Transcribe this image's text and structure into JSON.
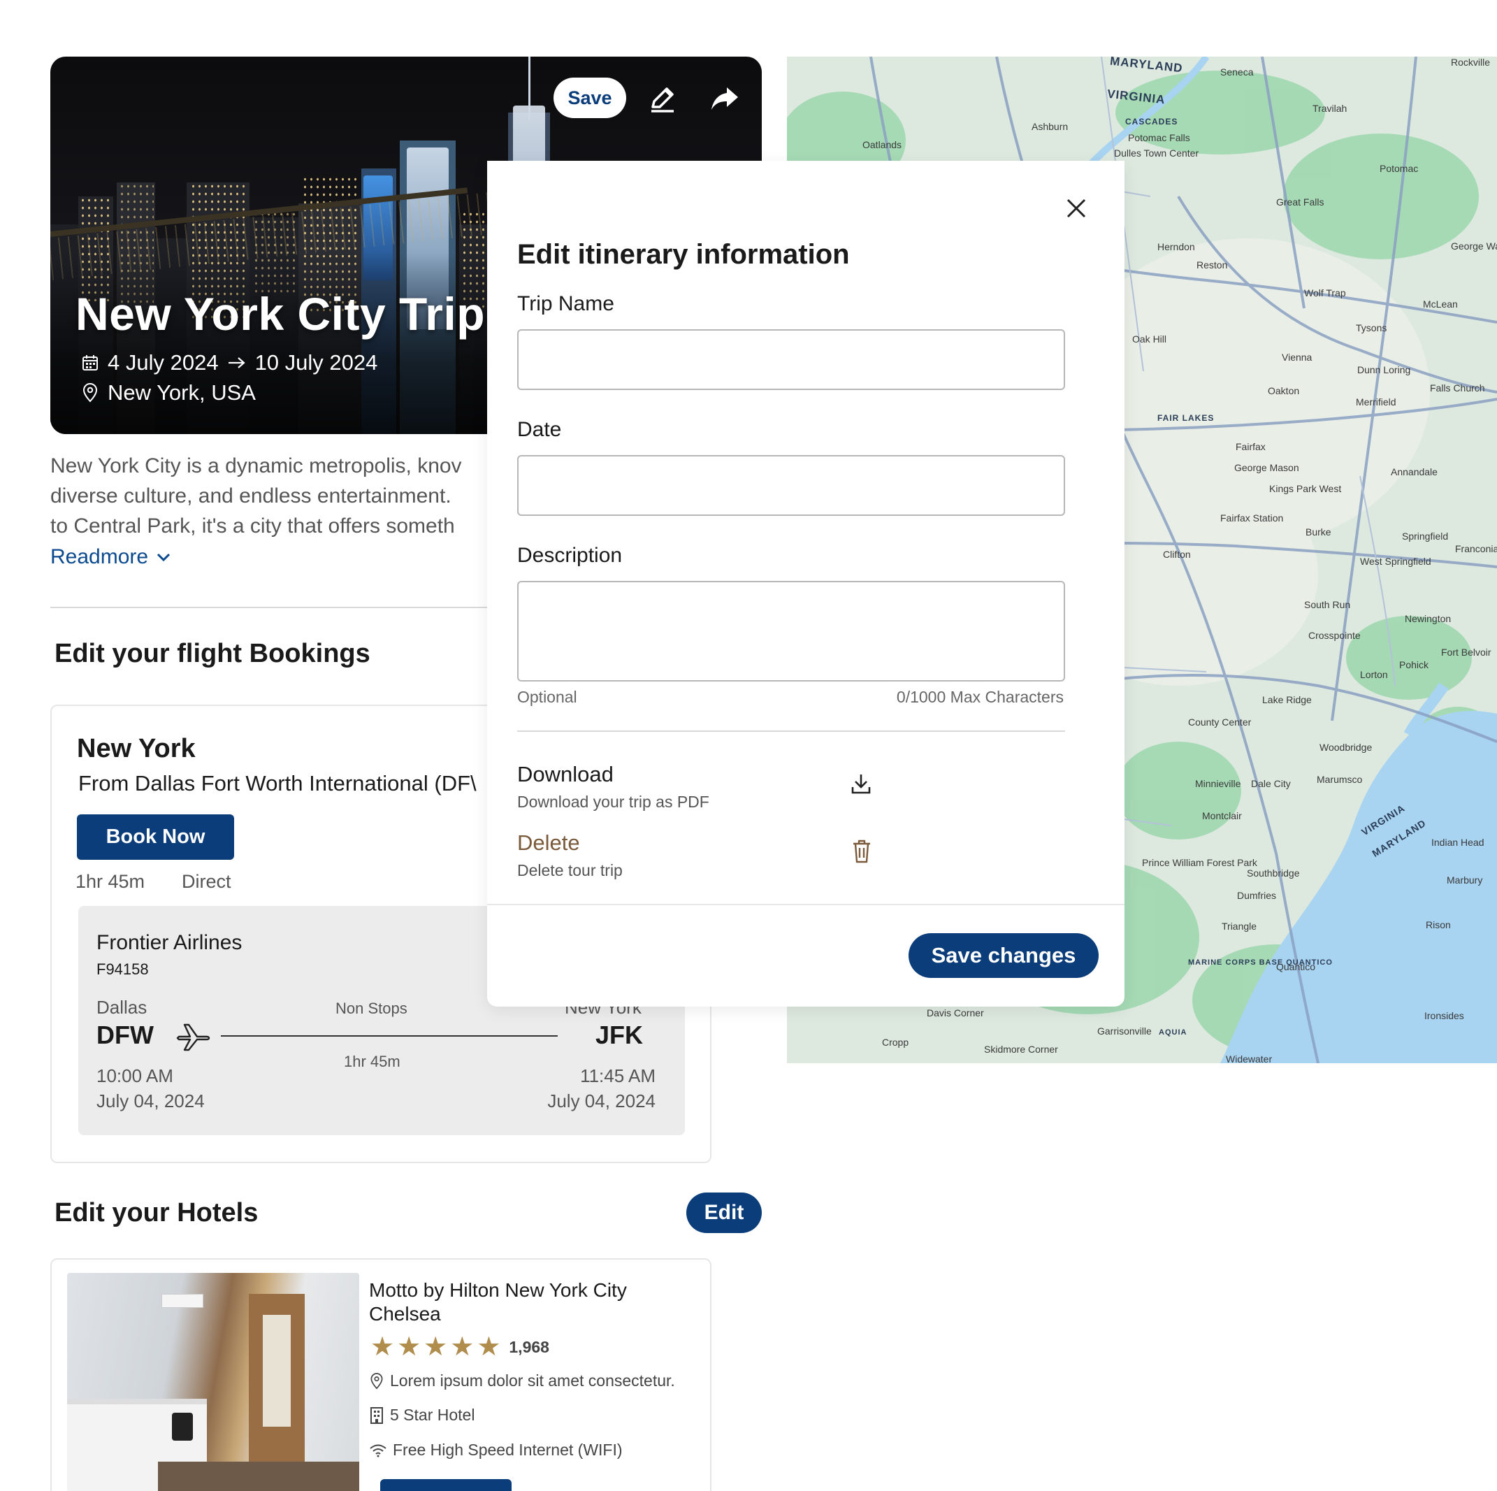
{
  "hero": {
    "title": "New York City Trip",
    "date_start": "4 July 2024",
    "date_end": "10 July 2024",
    "location": "New York, USA",
    "save_label": "Save",
    "icons": [
      "calendar-icon",
      "arrow-right-icon",
      "location-pin-icon",
      "pencil-icon",
      "share-icon"
    ]
  },
  "description": {
    "line1": "New York City is a dynamic metropolis, knov",
    "line2": "diverse culture, and endless entertainment.",
    "line3": "to Central Park, it's a city that offers someth",
    "readmore_label": "Readmore"
  },
  "flights": {
    "section_title": "Edit your flight Bookings",
    "destination": "New York",
    "origin_text": "From Dallas Fort Worth International (DF\\",
    "book_label": "Book Now",
    "duration": "1hr 45m",
    "stops": "Direct",
    "airline": "Frontier Airlines",
    "flight_no": "F94158",
    "from_city": "Dallas",
    "from_code": "DFW",
    "to_city": "New York",
    "to_code": "JFK",
    "route_stops": "Non Stops",
    "route_duration": "1hr 45m",
    "dep_time": "10:00 AM",
    "dep_date": "July 04, 2024",
    "arr_time": "11:45 AM",
    "arr_date": "July 04, 2024"
  },
  "hotels": {
    "section_title": "Edit your Hotels",
    "edit_label": "Edit",
    "name_line1": "Motto by Hilton New York City",
    "name_line2": "Chelsea",
    "rating_stars": 5,
    "reviews": "1,968",
    "address": "Lorem ipsum dolor sit amet consectetur.",
    "class": "5 Star Hotel",
    "amenity": "Free High Speed Internet (WIFI)"
  },
  "modal": {
    "title": "Edit itinerary information",
    "trip_name_label": "Trip Name",
    "trip_name_value": "",
    "date_label": "Date",
    "date_value": "",
    "description_label": "Description",
    "description_value": "",
    "optional_label": "Optional",
    "char_count": "0/1000 Max Characters",
    "download_title": "Download",
    "download_sub": "Download your trip as PDF",
    "delete_title": "Delete",
    "delete_sub": "Delete tour trip",
    "save_label": "Save changes"
  },
  "map": {
    "labels": [
      "MARYLAND",
      "VIRGINIA",
      "Seneca",
      "Rockville",
      "Travilah",
      "Potomac",
      "Ashburn",
      "Oatlands",
      "CASCADES",
      "Potomac Falls",
      "Dulles Town Center",
      "Great Falls",
      "Herndon",
      "Reston",
      "George Washington Memorial Parkway",
      "Wolf Trap",
      "McLean",
      "Tysons",
      "Oak Hill",
      "Vienna",
      "Dunn Loring",
      "Falls Church",
      "Oakton",
      "Merrifield",
      "FAIR LAKES",
      "Fairfax",
      "George Mason",
      "Annandale",
      "Kings Park West",
      "Fairfax Station",
      "Burke",
      "Springfield",
      "Franconia",
      "Clifton",
      "West Springfield",
      "South Run",
      "Newington",
      "Crosspointe",
      "Fort Belvoir",
      "Pohick",
      "Lorton",
      "Lake Ridge",
      "County Center",
      "Woodbridge",
      "Minnieville",
      "Dale City",
      "Marumsco",
      "Montclair",
      "Indian Head",
      "Prince William Forest Park",
      "Southbridge",
      "Dumfries",
      "Marbury",
      "Triangle",
      "Rison",
      "MARINE CORPS BASE QUANTICO",
      "Quantico",
      "Davis Corner",
      "Ironsides",
      "Cropp",
      "Garrisonville",
      "AQUIA",
      "Skidmore Corner",
      "Widewater"
    ],
    "colors": {
      "land": "#dde9df",
      "park": "#9fd8b0",
      "water": "#a8d3f1",
      "road": "#8aa0c2"
    }
  }
}
